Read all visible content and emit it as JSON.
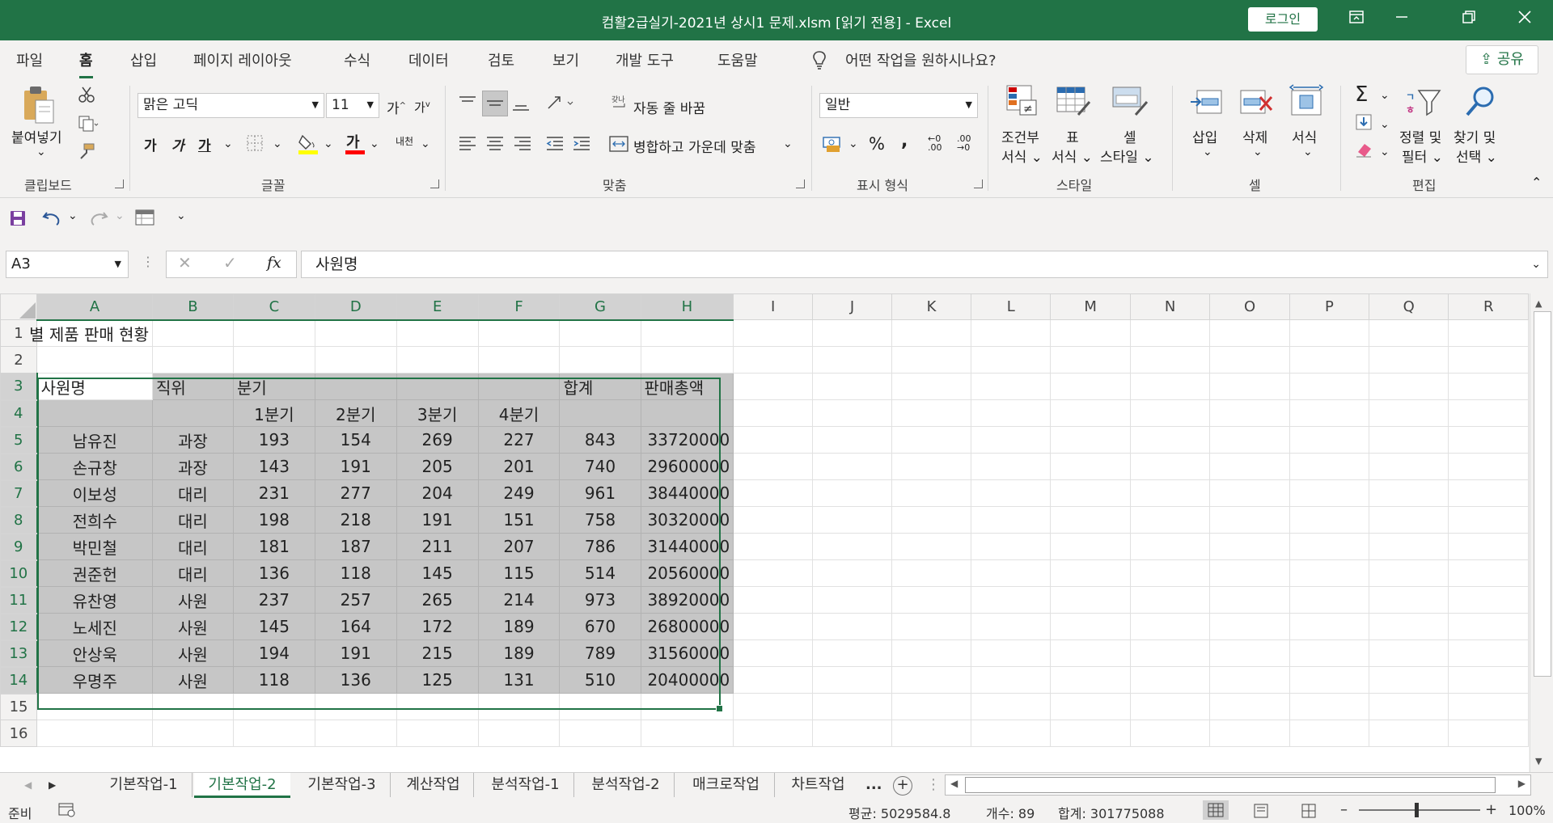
{
  "titlebar": {
    "title": "컴활2급실기-2021년 상시1 문제.xlsm  [읽기 전용]  -  Excel",
    "login_label": "로그인",
    "ribbon_display_icon": "ribbon-display-icon",
    "minimize_icon": "minimize-icon",
    "restore_icon": "restore-icon",
    "close_icon": "close-icon"
  },
  "menu": {
    "tabs": [
      "파일",
      "홈",
      "삽입",
      "페이지 레이아웃",
      "수식",
      "데이터",
      "검토",
      "보기",
      "개발 도구",
      "도움말"
    ],
    "active_tab": "홈",
    "tell_me": "어떤 작업을 원하시나요?",
    "share_label": "공유"
  },
  "ribbon": {
    "clipboard": {
      "paste_label": "붙여넣기",
      "group_label": "클립보드"
    },
    "font": {
      "font_name": "맑은 고딕",
      "font_size": "11",
      "grow": "가",
      "shrink": "가",
      "bold": "가",
      "italic": "가",
      "underline": "가",
      "font_color_letter": "가",
      "phonetic": "내천",
      "group_label": "글꼴",
      "fill_color": "#ffff00",
      "text_color": "#ff0000"
    },
    "alignment": {
      "wrap_text": "자동 줄 바꿈",
      "merge_center": "병합하고 가운데 맞춤",
      "group_label": "맞춤"
    },
    "number": {
      "format": "일반",
      "percent": "%",
      "comma": ",",
      "inc_decimal": "←0 .00",
      "dec_decimal": ".00 →0",
      "group_label": "표시 형식"
    },
    "styles": {
      "conditional_1": "조건부",
      "conditional_2": "서식",
      "table_1": "표",
      "table_2": "서식",
      "cell_1": "셀",
      "cell_2": "스타일",
      "group_label": "스타일"
    },
    "cells": {
      "insert": "삽입",
      "delete": "삭제",
      "format": "서식",
      "group_label": "셀"
    },
    "editing": {
      "sort_1": "정렬 및",
      "sort_2": "필터",
      "find_1": "찾기 및",
      "find_2": "선택",
      "group_label": "편집"
    }
  },
  "formula_bar": {
    "name_box": "A3",
    "cancel": "✕",
    "enter": "✓",
    "fx": "fx",
    "content": "사원명"
  },
  "sheet": {
    "columns": [
      "A",
      "B",
      "C",
      "D",
      "E",
      "F",
      "G",
      "H",
      "I",
      "J",
      "K",
      "L",
      "M",
      "N",
      "O",
      "P",
      "Q",
      "R"
    ],
    "selected_columns": [
      "A",
      "B",
      "C",
      "D",
      "E",
      "F",
      "G",
      "H"
    ],
    "row_numbers": [
      "1",
      "2",
      "3",
      "4",
      "5",
      "6",
      "7",
      "8",
      "9",
      "10",
      "11",
      "12",
      "13",
      "14",
      "15",
      "16"
    ],
    "r1_title": "별 제품 판매 현황",
    "header1": [
      "사원명",
      "직위",
      "분기",
      "",
      "",
      "",
      "합계",
      "판매총액"
    ],
    "header2": [
      "",
      "",
      "1분기",
      "2분기",
      "3분기",
      "4분기",
      "",
      ""
    ],
    "rows": [
      [
        "남유진",
        "과장",
        "193",
        "154",
        "269",
        "227",
        "843",
        "33720000"
      ],
      [
        "손규창",
        "과장",
        "143",
        "191",
        "205",
        "201",
        "740",
        "29600000"
      ],
      [
        "이보성",
        "대리",
        "231",
        "277",
        "204",
        "249",
        "961",
        "38440000"
      ],
      [
        "전희수",
        "대리",
        "198",
        "218",
        "191",
        "151",
        "758",
        "30320000"
      ],
      [
        "박민철",
        "대리",
        "181",
        "187",
        "211",
        "207",
        "786",
        "31440000"
      ],
      [
        "권준헌",
        "대리",
        "136",
        "118",
        "145",
        "115",
        "514",
        "20560000"
      ],
      [
        "유찬영",
        "사원",
        "237",
        "257",
        "265",
        "214",
        "973",
        "38920000"
      ],
      [
        "노세진",
        "사원",
        "145",
        "164",
        "172",
        "189",
        "670",
        "26800000"
      ],
      [
        "안상욱",
        "사원",
        "194",
        "191",
        "215",
        "189",
        "789",
        "31560000"
      ],
      [
        "우명주",
        "사원",
        "118",
        "136",
        "125",
        "131",
        "510",
        "20400000"
      ]
    ]
  },
  "sheet_tabs": {
    "tabs": [
      "기본작업-1",
      "기본작업-2",
      "기본작업-3",
      "계산작업",
      "분석작업-1",
      "분석작업-2",
      "매크로작업",
      "차트작업"
    ],
    "active": "기본작업-2",
    "more": "...",
    "add": "+"
  },
  "status": {
    "ready": "준비",
    "average": "평균: 5029584.8",
    "count": "개수: 89",
    "sum": "합계: 301775088",
    "zoom": "100%"
  },
  "colors": {
    "brand_green": "#217346",
    "selection_fill": "#c6c6c6"
  }
}
